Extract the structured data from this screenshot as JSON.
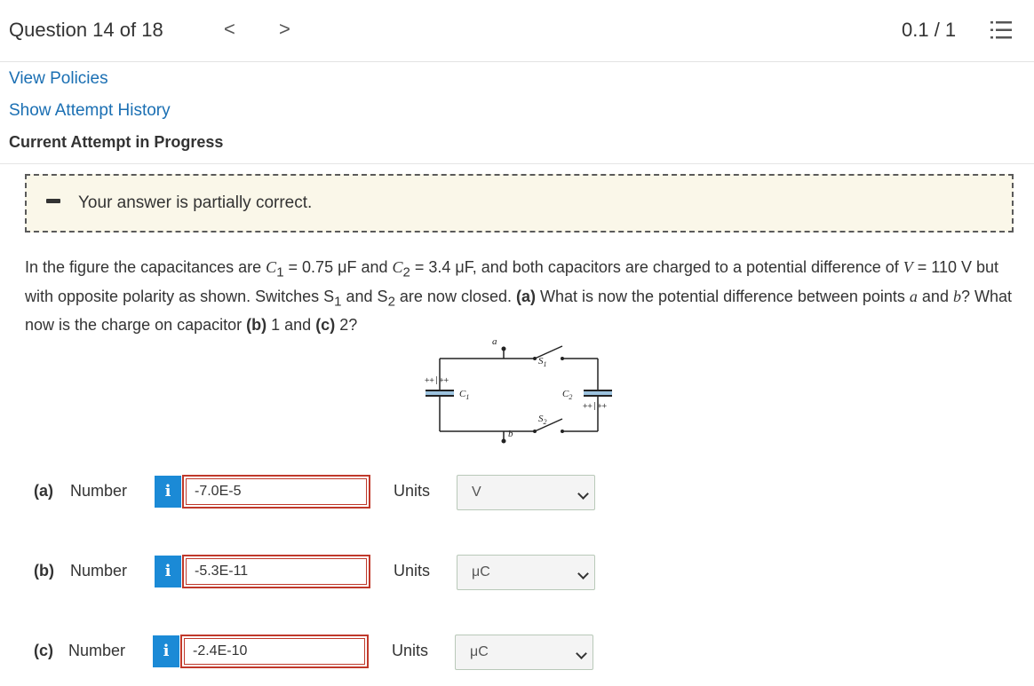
{
  "header": {
    "question_label": "Question 14 of 18",
    "prev": "<",
    "next": ">",
    "score": "0.1 / 1",
    "list_icon": "list-icon"
  },
  "links": {
    "view_policies": "View Policies",
    "show_attempt_history": "Show Attempt History"
  },
  "attempt_status": "Current Attempt in Progress",
  "feedback": {
    "icon": "partial-icon",
    "text": "Your answer is partially correct."
  },
  "problem": {
    "s1": "In the figure the capacitances are ",
    "c1": "C",
    "c1_sub": "1",
    "s2": " = 0.75 μF and ",
    "c2": "C",
    "c2_sub": "2",
    "s3": " = 3.4 μF, and both capacitors are charged to a potential difference of ",
    "v": "V",
    "s4": " = 110 V but with opposite polarity as shown. Switches S",
    "sw1_sub": "1",
    "s5": " and S",
    "sw2_sub": "2",
    "s6": " are now closed. ",
    "part_a": "(a)",
    "s7": " What is now the potential difference between points ",
    "pa": "a",
    "s8": " and ",
    "pb": "b",
    "s9": "? What now is the charge on capacitor ",
    "part_b": "(b)",
    "s10": " 1 and ",
    "part_c": "(c)",
    "s11": " 2?"
  },
  "figure": {
    "point_a": "a",
    "point_b": "b",
    "s1": "S",
    "s1_sub": "1",
    "s2": "S",
    "s2_sub": "2",
    "c1": "C",
    "c1_sub": "1",
    "c2": "C",
    "c2_sub": "2",
    "plus_top_c1": "++|++",
    "plus_bottom_c2": "++|++"
  },
  "answers": [
    {
      "part": "(a)",
      "label": "Number",
      "info": "i",
      "value": "-7.0E-5",
      "units_label": "Units",
      "unit": "V"
    },
    {
      "part": "(b)",
      "label": "Number",
      "info": "i",
      "value": "-5.3E-11",
      "units_label": "Units",
      "unit": "μC"
    },
    {
      "part": "(c)",
      "label": "Number",
      "info": "i",
      "value": "-2.4E-10",
      "units_label": "Units",
      "unit": "μC"
    }
  ],
  "colors": {
    "link": "#1a6fb3",
    "info_button": "#1b8ad6",
    "input_border_incorrect": "#c0392b",
    "feedback_bg": "#faf7e9"
  }
}
